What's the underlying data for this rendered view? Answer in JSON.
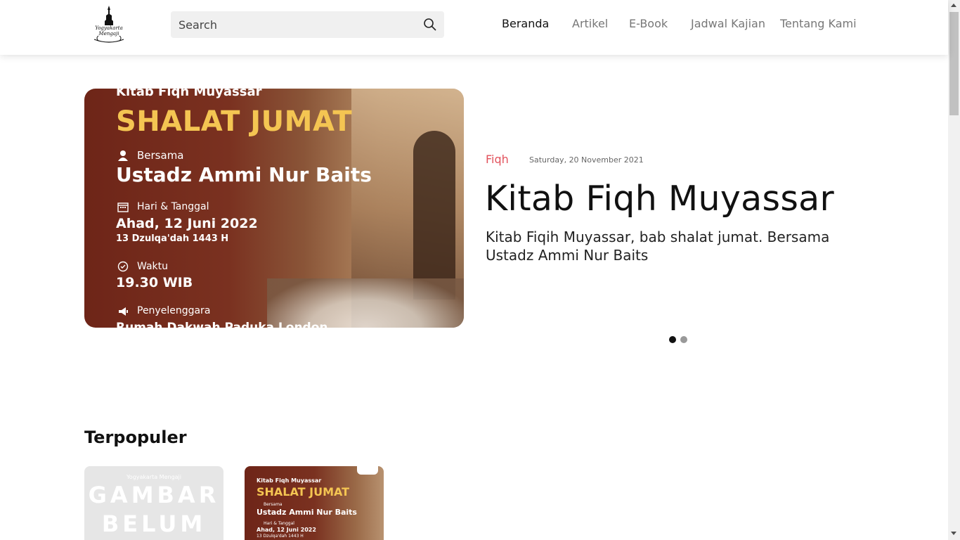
{
  "header": {
    "logo_text_1": "Yogyakarta",
    "logo_text_2": "Mengaji",
    "search_placeholder": "Search",
    "nav": [
      "Beranda",
      "Artikel",
      "E-Book",
      "Jadwal Kajian",
      "Tentang Kami"
    ],
    "active_nav": "Beranda"
  },
  "hero": {
    "banner": {
      "top_line": "Kitab Fiqh Muyassar",
      "title": "SHALAT JUMAT",
      "bersama_label": "Bersama",
      "speaker": "Ustadz Ammi Nur Baits",
      "date_label": "Hari & Tanggal",
      "date": "Ahad, 12 Juni 2022",
      "hijri": "13 Dzulqa'dah 1443 H",
      "time_label": "Waktu",
      "time": "19.30 WIB",
      "organizer_label": "Penyelenggara",
      "organizer": "Rumah Dakwah Paduka London"
    },
    "category": "Fiqh",
    "date": "Saturday, 20 November 2021",
    "title": "Kitab Fiqh Muyassar",
    "description": "Kitab Fiqih Muyassar, bab shalat jumat. Bersama Ustadz Ammi Nur Baits",
    "carousel_active_index": 0,
    "carousel_count": 2
  },
  "popular": {
    "title": "Terpopuler",
    "cards": [
      {
        "brand": "Yogyakarta Mengaji",
        "line1": "GAMBAR",
        "line2": "BELUM"
      },
      {
        "top_line": "Kitab Fiqh Muyassar",
        "title": "SHALAT JUMAT",
        "bersama_label": "Bersama",
        "speaker": "Ustadz Ammi Nur Baits",
        "date_label": "Hari & Tanggal",
        "date": "Ahad, 12 Juni 2022",
        "hijri": "13 Dzulqa'dah 1443 H"
      }
    ]
  },
  "colors": {
    "accent_category": "#e2525c",
    "banner_title": "#f4c552",
    "banner_bg": "#7a3120"
  }
}
